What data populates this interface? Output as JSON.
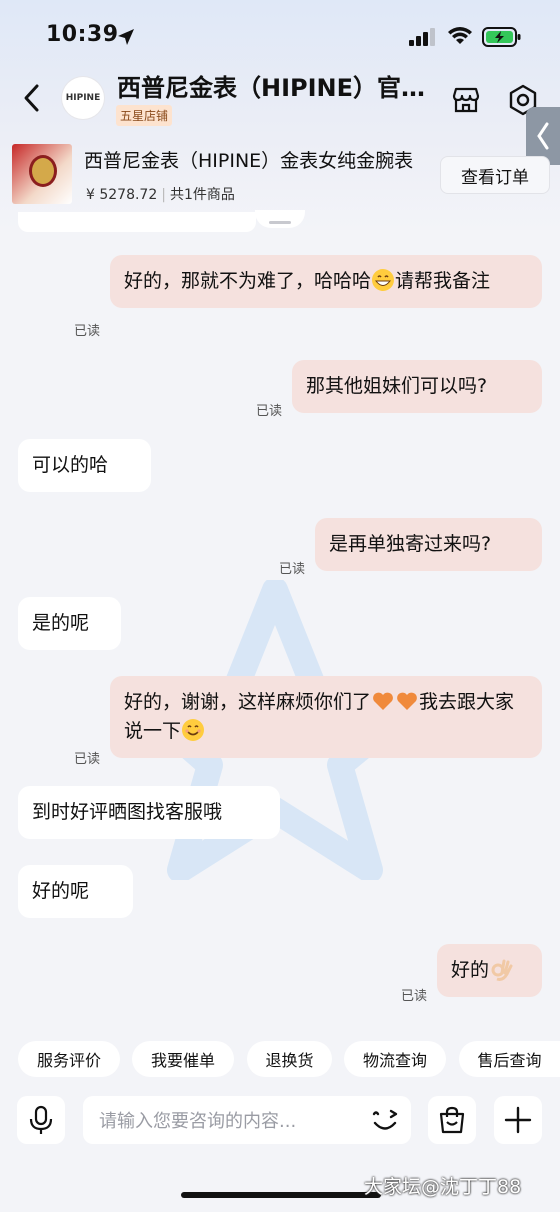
{
  "status_bar": {
    "time": "10:39"
  },
  "header": {
    "shop_name": "西普尼金表（HIPINE）官方旗舰店",
    "badge": "五星店铺",
    "logo_text": "HIPINE"
  },
  "product": {
    "title": "西普尼金表（HIPINE）金表女纯金腕表",
    "price": "¥ 5278.72",
    "count": "共1件商品",
    "view_order_label": "查看订单"
  },
  "messages": [
    {
      "side": "sent",
      "text_a": "好的，那就不为难了，哈哈哈",
      "emoji_a": "grin-emoji",
      "text_b": "请帮我备注",
      "read": "已读"
    },
    {
      "side": "sent",
      "text": "那其他姐妹们可以吗?",
      "read": "已读"
    },
    {
      "side": "recv",
      "text": "可以的哈"
    },
    {
      "side": "sent",
      "text": "是再单独寄过来吗?",
      "read": "已读"
    },
    {
      "side": "recv",
      "text": "是的呢"
    },
    {
      "side": "sent",
      "text_a": "好的，谢谢，这样麻烦你们了",
      "emoji_a": "orange-heart-emoji",
      "text_b": "我去跟大家说一下",
      "emoji_b": "smile-emoji",
      "read": "已读"
    },
    {
      "side": "recv",
      "text": "到时好评晒图找客服哦"
    },
    {
      "side": "recv",
      "text": "好的呢"
    },
    {
      "side": "sent",
      "text": "好的",
      "emoji_a": "ok-hand-emoji",
      "read": "已读"
    }
  ],
  "quick_actions": [
    "服务评价",
    "我要催单",
    "退换货",
    "物流查询",
    "售后查询"
  ],
  "input": {
    "placeholder": "请输入您要咨询的内容..."
  },
  "watermark": "大家坛@沈丁丁88",
  "colors": {
    "sent_bubble": "#f5e1de",
    "recv_bubble": "#ffffff",
    "background": "#f3f4f8",
    "badge_bg": "#fde3cf"
  }
}
